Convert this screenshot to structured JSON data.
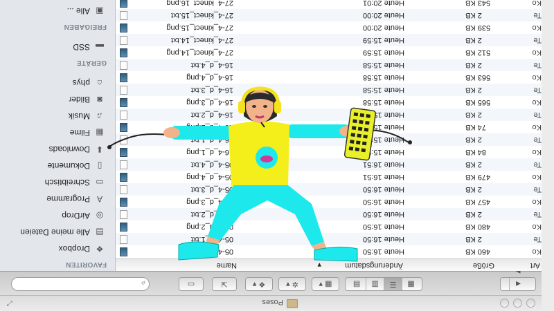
{
  "window": {
    "title": "Poses",
    "toolbar": {
      "back": "◀",
      "forward": "▶",
      "search_placeholder": ""
    }
  },
  "sidebar": {
    "sections": [
      {
        "label": "FAVORITEN",
        "items": [
          {
            "label": "Dropbox",
            "icon": "dropbox-icon"
          },
          {
            "label": "Alle meine Dateien",
            "icon": "all-files-icon"
          },
          {
            "label": "AirDrop",
            "icon": "airdrop-icon"
          },
          {
            "label": "Programme",
            "icon": "applications-icon"
          },
          {
            "label": "Schreibtisch",
            "icon": "desktop-icon"
          },
          {
            "label": "Dokumente",
            "icon": "documents-icon"
          },
          {
            "label": "Downloads",
            "icon": "downloads-icon"
          },
          {
            "label": "Filme",
            "icon": "movies-icon"
          },
          {
            "label": "Musik",
            "icon": "music-icon"
          },
          {
            "label": "Bilder",
            "icon": "pictures-icon"
          },
          {
            "label": "phys",
            "icon": "home-icon"
          }
        ]
      },
      {
        "label": "GERÄTE",
        "items": [
          {
            "label": "SSD",
            "icon": "disk-icon"
          }
        ]
      },
      {
        "label": "FREIGABEN",
        "items": [
          {
            "label": "Alle ...",
            "icon": "network-icon"
          }
        ]
      }
    ]
  },
  "columns": {
    "name": "Name",
    "date": "Änderungsdatum",
    "size": "Größe",
    "kind": "Art"
  },
  "files": [
    {
      "name": "05-4_d_1.png",
      "date": "Heute 16:50",
      "size": "460 KB",
      "kind": "Ko",
      "type": "png"
    },
    {
      "name": "05-4_d_1.txt",
      "date": "Heute 16:50",
      "size": "2 KB",
      "kind": "Te",
      "type": "txt"
    },
    {
      "name": "05-4_d_2.png",
      "date": "Heute 16:50",
      "size": "480 KB",
      "kind": "Ko",
      "type": "png"
    },
    {
      "name": "05-4_d_2.txt",
      "date": "Heute 16:50",
      "size": "2 KB",
      "kind": "Te",
      "type": "txt"
    },
    {
      "name": "05-4_d_3.png",
      "date": "Heute 16:50",
      "size": "457 KB",
      "kind": "Ko",
      "type": "png"
    },
    {
      "name": "05-4_d_3.txt",
      "date": "Heute 16:50",
      "size": "2 KB",
      "kind": "Te",
      "type": "txt"
    },
    {
      "name": "05-4_d_4.png",
      "date": "Heute 16:51",
      "size": "479 KB",
      "kind": "Ko",
      "type": "png"
    },
    {
      "name": "05-4_d_4.txt",
      "date": "Heute 16:51",
      "size": "2 KB",
      "kind": "Te",
      "type": "txt"
    },
    {
      "name": "16-4_d_1.png",
      "date": "Heute 15:57",
      "size": "84 KB",
      "kind": "Ko",
      "type": "png"
    },
    {
      "name": "16-4_d_1.txt",
      "date": "Heute 15:57",
      "size": "2 KB",
      "kind": "Te",
      "type": "txt"
    },
    {
      "name": "16-4_d_2.png",
      "date": "Heute 15:57",
      "size": "74 KB",
      "kind": "Ko",
      "type": "png"
    },
    {
      "name": "16-4_d_2.txt",
      "date": "Heute 15:57",
      "size": "2 KB",
      "kind": "Te",
      "type": "txt"
    },
    {
      "name": "16-4_d_3.png",
      "date": "Heute 15:58",
      "size": "565 KB",
      "kind": "Ko",
      "type": "png"
    },
    {
      "name": "16-4_d_3.txt",
      "date": "Heute 15:58",
      "size": "2 KB",
      "kind": "Te",
      "type": "txt"
    },
    {
      "name": "16-4_d_4.png",
      "date": "Heute 15:58",
      "size": "563 KB",
      "kind": "Ko",
      "type": "png"
    },
    {
      "name": "16-4_d_4.txt",
      "date": "Heute 15:58",
      "size": "2 KB",
      "kind": "Te",
      "type": "txt"
    },
    {
      "name": "27-4_kinect_14.png",
      "date": "Heute 15:59",
      "size": "512 KB",
      "kind": "Ko",
      "type": "png"
    },
    {
      "name": "27-4_kinect_14.txt",
      "date": "Heute 15:59",
      "size": "2 KB",
      "kind": "Te",
      "type": "txt"
    },
    {
      "name": "27-4_kinect_15.png",
      "date": "Heute 20:00",
      "size": "539 KB",
      "kind": "Ko",
      "type": "png"
    },
    {
      "name": "27-4_kinect_15.txt",
      "date": "Heute 20:00",
      "size": "2 KB",
      "kind": "Te",
      "type": "txt"
    },
    {
      "name": "27-4_kinect_16.png",
      "date": "Heute 20:01",
      "size": "543 KB",
      "kind": "Ko",
      "type": "png"
    }
  ],
  "avatar": {
    "shirt_color": "#f4ee1a",
    "pants_color": "#1de9ec",
    "headphones_color": "#f6e21c",
    "keyboard_color": "#e9f02a"
  }
}
